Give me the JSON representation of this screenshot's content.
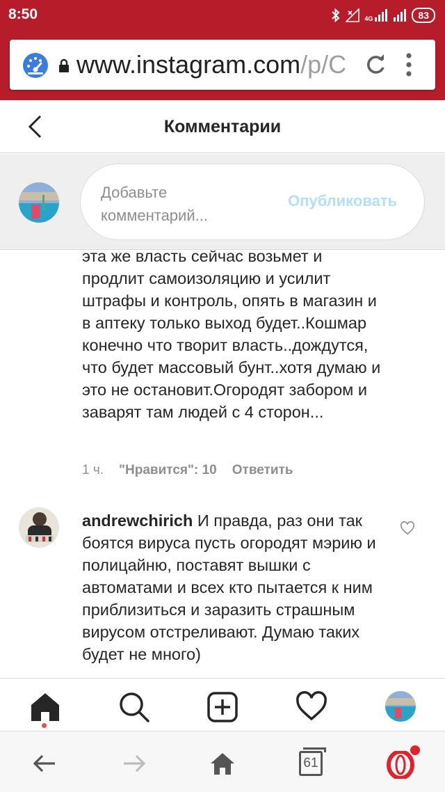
{
  "status_bar": {
    "time": "8:50",
    "network": "4G",
    "battery": "83"
  },
  "browser": {
    "url_host": "www.instagram.com",
    "url_path": "/p/C",
    "icons": [
      "speed-dial-icon",
      "lock-icon",
      "reload-icon",
      "overflow-menu-icon"
    ]
  },
  "header": {
    "title": "Комментарии"
  },
  "composer": {
    "placeholder": "Добавьте комментарий...",
    "publish_label": "Опубликовать"
  },
  "comments": [
    {
      "text": "эта же власть сейчас возьмет и продлит самоизоляцию и усилит штрафы и контроль, опять в магазин и в аптеку только выход будет..Кошмар конечно что творит власть..дождутся, что будет массовый бунт..хотя думаю и это не остановит.Огородят забором и заварят там людей с 4 сторон...",
      "time": "1 ч.",
      "likes": "\"Нравится\": 10",
      "reply": "Ответить"
    },
    {
      "username": "andrewchirich",
      "text": "И правда, раз они так боятся вируса пусть огородят мэрию и полицайню, поставят вышки с автоматами и всех кто пытается к ним приблизиться и заразить страшным вирусом отстреливают. Думаю таких будет не много)"
    }
  ],
  "ig_nav": [
    "home-icon",
    "search-icon",
    "new-post-icon",
    "activity-heart-icon",
    "profile-avatar"
  ],
  "browser_nav": {
    "tabs_count": "61"
  },
  "colors": {
    "brand_red": "#b71c2b",
    "publish_disabled": "#b2dffc",
    "notification_dot": "#ed4956"
  }
}
